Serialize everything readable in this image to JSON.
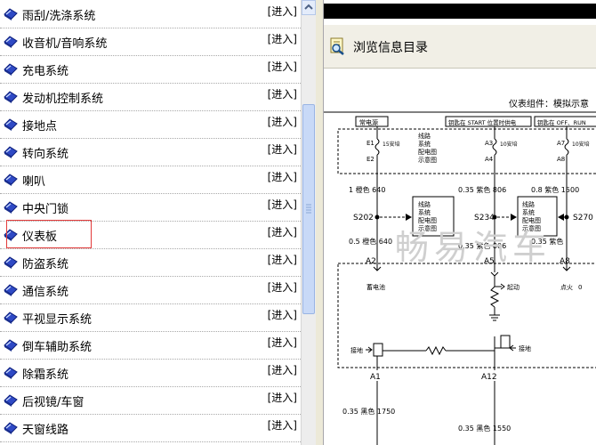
{
  "window": {
    "left_pane": {
      "enter_label": "[进入]",
      "items": [
        {
          "label": "雨刮/洗涤系统",
          "selected": false
        },
        {
          "label": "收音机/音响系统",
          "selected": false
        },
        {
          "label": "充电系统",
          "selected": false
        },
        {
          "label": "发动机控制系统",
          "selected": false
        },
        {
          "label": "接地点",
          "selected": false
        },
        {
          "label": "转向系统",
          "selected": false
        },
        {
          "label": "喇叭",
          "selected": false
        },
        {
          "label": "中央门锁",
          "selected": false
        },
        {
          "label": "仪表板",
          "selected": true
        },
        {
          "label": "防盗系统",
          "selected": false
        },
        {
          "label": "通信系统",
          "selected": false
        },
        {
          "label": "平视显示系统",
          "selected": false
        },
        {
          "label": "倒车辅助系统",
          "selected": false
        },
        {
          "label": "除霜系统",
          "selected": false
        },
        {
          "label": "后视镜/车窗",
          "selected": false
        },
        {
          "label": "天窗线路",
          "selected": false
        }
      ]
    },
    "right_pane": {
      "toolbar_title": "浏览信息目录",
      "diagram": {
        "heading": "仪表组件：模拟示意",
        "power_labels": [
          "常电源",
          "钥匙在 START 位置时供电",
          "钥匙在 OFF、RUN"
        ],
        "fuses": {
          "f1": {
            "top": "E1",
            "bottom": "E2",
            "rating": "15安培"
          },
          "f2": {
            "top": "A3",
            "bottom": "A4",
            "rating": "10安培"
          },
          "f3": {
            "top": "A7",
            "bottom": "A8",
            "rating": "10安培"
          }
        },
        "wires": {
          "w1a": "1 橙色 640",
          "w1b": "0.5 橙色 640",
          "w2a": "0.35 紫色 806",
          "w2b": "0.35 紫色 806",
          "w3a": "0.8 紫色 1500",
          "w3b": "0.35 紫色"
        },
        "splices": [
          "S202",
          "S234",
          "S270"
        ],
        "ref_box": [
          "线路",
          "系统",
          "配电图",
          "示意图"
        ],
        "pins": [
          "A2",
          "A5",
          "A8",
          "A1",
          "A12"
        ],
        "pin_labels": {
          "battery": "蓄电池",
          "start": "起动",
          "ign": "点火",
          "ign_val": "0"
        },
        "ground_label": "接地",
        "bottom_wires": {
          "left": "0.35 黑色 1750",
          "right": "0.35 黑色 1550"
        },
        "watermark": "畅易汽车"
      }
    }
  }
}
